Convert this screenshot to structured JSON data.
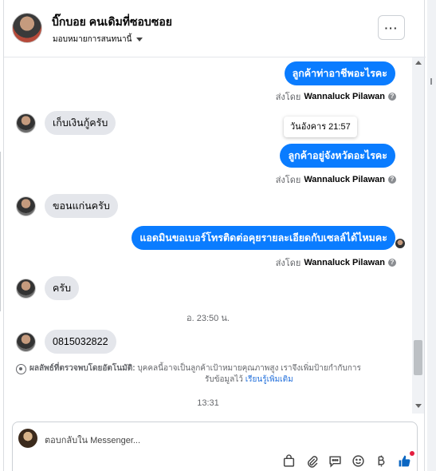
{
  "header": {
    "contact_name": "บิ๊กบอย คนเดิมที่ซอบซอย",
    "assign_label": "มอบหมายการสนทนานี้",
    "more_label": "···"
  },
  "messages": [
    {
      "side": "out",
      "text": "ลูกค้าท่าอาชีพอะไรคะ"
    },
    {
      "side": "sent_by",
      "prefix": "ส่งโดย",
      "agent": "Wannaluck Pilawan"
    },
    {
      "side": "in",
      "text": "เก็บเงินกู้ครับ"
    },
    {
      "side": "tooltip",
      "text": "วันอังคาร 21:57"
    },
    {
      "side": "out",
      "text": "ลูกค้าอยู่จังหวัดอะไรคะ"
    },
    {
      "side": "sent_by",
      "prefix": "ส่งโดย",
      "agent": "Wannaluck Pilawan"
    },
    {
      "side": "in",
      "text": "ขอนแก่นครับ"
    },
    {
      "side": "out",
      "text": "แอดมินขอเบอร์โทรติดต่อคุยรายละเอียดกับเซลล์ได้ไหมคะ"
    },
    {
      "side": "sent_by",
      "prefix": "ส่งโดย",
      "agent": "Wannaluck Pilawan"
    },
    {
      "side": "in",
      "text": "ครับ"
    },
    {
      "side": "time",
      "text": "อ. 23:50 น."
    },
    {
      "side": "in",
      "text": "0815032822"
    },
    {
      "side": "time",
      "text": "13:31"
    }
  ],
  "detection": {
    "title": "ผลลัพธ์ที่ตรวจพบโดยอัตโนมัติ:",
    "text_line1": "บุคคลนี้อาจเป็นลูกค้าเป้าหมายคุณภาพสูง เราจึงเพิ่มป้ายกำกับการ",
    "text_line2": "รับข้อมูลไว้",
    "link": "เรียนรู้เพิ่มเติม"
  },
  "composer": {
    "placeholder": "ตอบกลับใน Messenger..."
  },
  "icons": [
    "bag-icon",
    "attachment-icon",
    "quick-reply-icon",
    "emoji-icon",
    "currency-icon",
    "like-icon"
  ],
  "colors": {
    "outgoing": "#0a7cff",
    "incoming": "#e4e6eb",
    "link": "#216fdb",
    "like": "#0a66c2"
  }
}
